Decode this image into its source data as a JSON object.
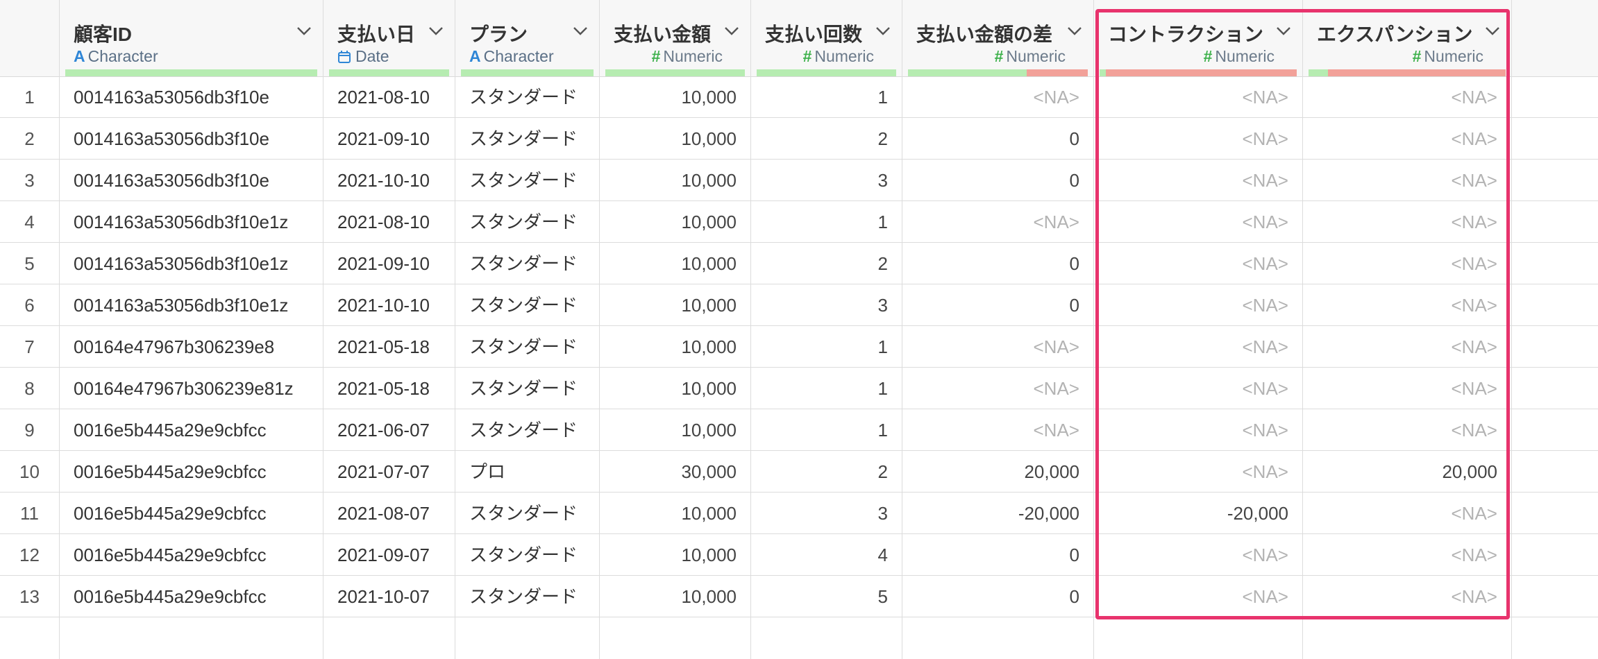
{
  "colors": {
    "header_bg": "#f7f7f7",
    "quality_ok": "#b6ecb1",
    "quality_bad": "#f2a199",
    "char_type": "#2f86d6",
    "date_type": "#2f86d6",
    "numeric_type": "#3cb04a",
    "highlight": "#e8336d",
    "na_text": "#b3b3b3"
  },
  "columns": [
    {
      "name": "顧客ID",
      "type": "Character",
      "type_icon": "A",
      "icon_name": "character-type-icon",
      "align": "left",
      "bad_pct": 0
    },
    {
      "name": "支払い日",
      "type": "Date",
      "type_icon": "",
      "icon_name": "calendar-icon",
      "align": "left",
      "bad_pct": 0
    },
    {
      "name": "プラン",
      "type": "Character",
      "type_icon": "A",
      "icon_name": "character-type-icon",
      "align": "left",
      "bad_pct": 0
    },
    {
      "name": "支払い金額",
      "type": "Numeric",
      "type_icon": "#",
      "icon_name": "numeric-type-icon",
      "align": "right",
      "bad_pct": 0
    },
    {
      "name": "支払い回数",
      "type": "Numeric",
      "type_icon": "#",
      "icon_name": "numeric-type-icon",
      "align": "right",
      "bad_pct": 0
    },
    {
      "name": "支払い金額の差",
      "type": "Numeric",
      "type_icon": "#",
      "icon_name": "numeric-type-icon",
      "align": "right",
      "bad_pct": 34
    },
    {
      "name": "コントラクション",
      "type": "Numeric",
      "type_icon": "#",
      "icon_name": "numeric-type-icon",
      "align": "right",
      "bad_pct": 97
    },
    {
      "name": "エクスパンション",
      "type": "Numeric",
      "type_icon": "#",
      "icon_name": "numeric-type-icon",
      "align": "right",
      "bad_pct": 90
    }
  ],
  "rows": [
    {
      "n": "1",
      "cells": [
        "0014163a53056db3f10e",
        "2021-08-10",
        "スタンダード",
        "10,000",
        "1",
        "<NA>",
        "<NA>",
        "<NA>"
      ]
    },
    {
      "n": "2",
      "cells": [
        "0014163a53056db3f10e",
        "2021-09-10",
        "スタンダード",
        "10,000",
        "2",
        "0",
        "<NA>",
        "<NA>"
      ]
    },
    {
      "n": "3",
      "cells": [
        "0014163a53056db3f10e",
        "2021-10-10",
        "スタンダード",
        "10,000",
        "3",
        "0",
        "<NA>",
        "<NA>"
      ]
    },
    {
      "n": "4",
      "cells": [
        "0014163a53056db3f10e1z",
        "2021-08-10",
        "スタンダード",
        "10,000",
        "1",
        "<NA>",
        "<NA>",
        "<NA>"
      ]
    },
    {
      "n": "5",
      "cells": [
        "0014163a53056db3f10e1z",
        "2021-09-10",
        "スタンダード",
        "10,000",
        "2",
        "0",
        "<NA>",
        "<NA>"
      ]
    },
    {
      "n": "6",
      "cells": [
        "0014163a53056db3f10e1z",
        "2021-10-10",
        "スタンダード",
        "10,000",
        "3",
        "0",
        "<NA>",
        "<NA>"
      ]
    },
    {
      "n": "7",
      "cells": [
        "00164e47967b306239e8",
        "2021-05-18",
        "スタンダード",
        "10,000",
        "1",
        "<NA>",
        "<NA>",
        "<NA>"
      ]
    },
    {
      "n": "8",
      "cells": [
        "00164e47967b306239e81z",
        "2021-05-18",
        "スタンダード",
        "10,000",
        "1",
        "<NA>",
        "<NA>",
        "<NA>"
      ]
    },
    {
      "n": "9",
      "cells": [
        "0016e5b445a29e9cbfcc",
        "2021-06-07",
        "スタンダード",
        "10,000",
        "1",
        "<NA>",
        "<NA>",
        "<NA>"
      ]
    },
    {
      "n": "10",
      "cells": [
        "0016e5b445a29e9cbfcc",
        "2021-07-07",
        "プロ",
        "30,000",
        "2",
        "20,000",
        "<NA>",
        "20,000"
      ]
    },
    {
      "n": "11",
      "cells": [
        "0016e5b445a29e9cbfcc",
        "2021-08-07",
        "スタンダード",
        "10,000",
        "3",
        "-20,000",
        "-20,000",
        "<NA>"
      ]
    },
    {
      "n": "12",
      "cells": [
        "0016e5b445a29e9cbfcc",
        "2021-09-07",
        "スタンダード",
        "10,000",
        "4",
        "0",
        "<NA>",
        "<NA>"
      ]
    },
    {
      "n": "13",
      "cells": [
        "0016e5b445a29e9cbfcc",
        "2021-10-07",
        "スタンダード",
        "10,000",
        "5",
        "0",
        "<NA>",
        "<NA>"
      ]
    }
  ]
}
